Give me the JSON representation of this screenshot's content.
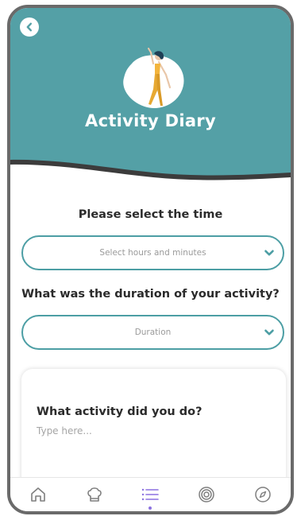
{
  "colors": {
    "header_teal": "#54a0a6",
    "wave_dark": "#3c3c3c",
    "field_border": "#4c9ea4",
    "accent_purple": "#8b71e0"
  },
  "header": {
    "title": "Activity Diary",
    "back_icon": "chevron-left-icon",
    "illustration": "woman-stretching-illustration"
  },
  "form": {
    "time": {
      "label": "Please select the time",
      "placeholder": "Select hours and minutes"
    },
    "duration": {
      "label": "What was the duration of your activity?",
      "placeholder": "Duration"
    },
    "activity": {
      "label": "What activity did you do?",
      "placeholder": "Type here..."
    }
  },
  "tabbar": {
    "tabs": [
      {
        "icon": "home-icon"
      },
      {
        "icon": "chef-hat-icon"
      },
      {
        "icon": "list-icon",
        "active": true
      },
      {
        "icon": "target-icon"
      },
      {
        "icon": "compass-icon"
      }
    ]
  }
}
